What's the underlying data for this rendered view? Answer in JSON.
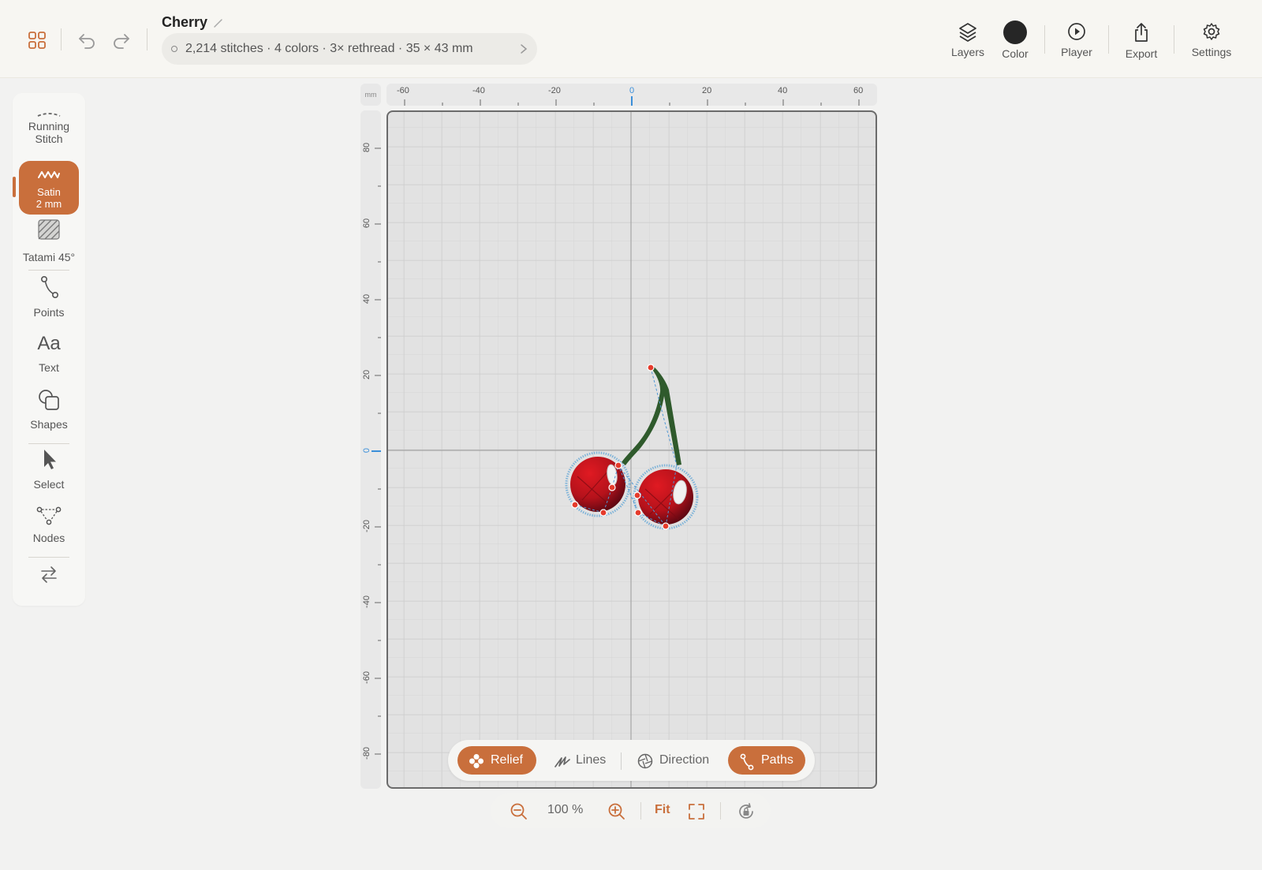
{
  "document": {
    "title": "Cherry",
    "stats": "2,214 stitches · 4 colors · 3× rethread · 35 × 43 mm"
  },
  "toolbar": {
    "layers_label": "Layers",
    "color_label": "Color",
    "player_label": "Player",
    "export_label": "Export",
    "settings_label": "Settings",
    "current_color": "#262626"
  },
  "sidebar": {
    "running_line1": "Running",
    "running_line2": "Stitch",
    "satin_line1": "Satin",
    "satin_line2": "2 mm",
    "tatami": "Tatami 45°",
    "points": "Points",
    "text": "Text",
    "shapes": "Shapes",
    "select": "Select",
    "nodes": "Nodes"
  },
  "ruler": {
    "unit": "mm",
    "x_ticks": [
      "-60",
      "-40",
      "-20",
      "0",
      "20",
      "40",
      "60"
    ],
    "y_ticks": [
      "80",
      "60",
      "40",
      "20",
      "0",
      "-20",
      "-40",
      "-60",
      "-80"
    ]
  },
  "modes": {
    "relief": "Relief",
    "lines": "Lines",
    "direction": "Direction",
    "paths": "Paths"
  },
  "zoom": {
    "value": "100 %",
    "fit": "Fit"
  },
  "colors": {
    "accent": "#c96f3c",
    "cherry": "#b5121b",
    "stem": "#2f5a2c"
  }
}
